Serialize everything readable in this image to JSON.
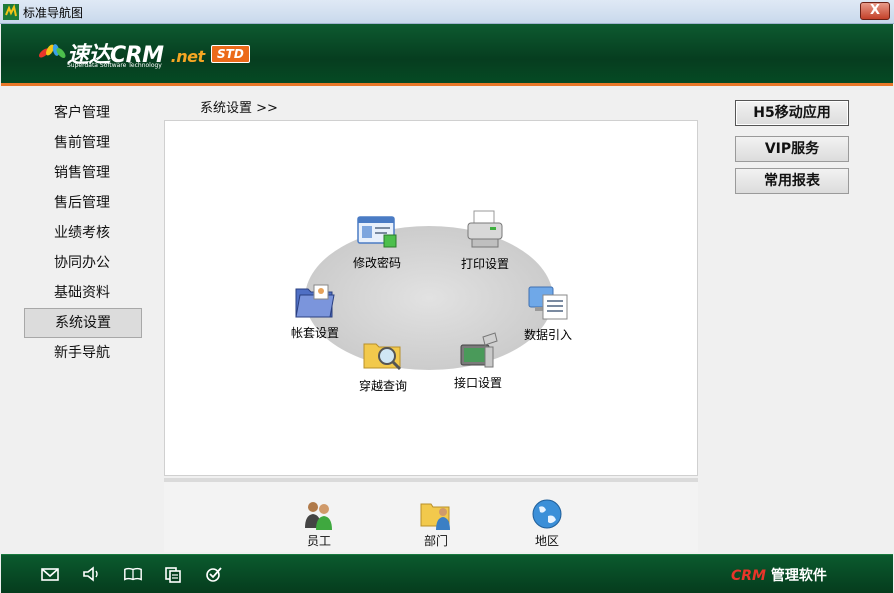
{
  "window": {
    "title": "标准导航图",
    "close_label": "X"
  },
  "header": {
    "logo_main": "速达CRM",
    "logo_net": ".net",
    "logo_sub": "Superdata Software Technology",
    "badge": "STD"
  },
  "nav": {
    "items": [
      {
        "label": "客户管理"
      },
      {
        "label": "售前管理"
      },
      {
        "label": "销售管理"
      },
      {
        "label": "售后管理"
      },
      {
        "label": "业绩考核"
      },
      {
        "label": "协同办公"
      },
      {
        "label": "基础资料"
      },
      {
        "label": "系统设置",
        "active": true
      },
      {
        "label": "新手导航"
      }
    ]
  },
  "breadcrumb": "系统设置 >>",
  "main": {
    "nodes": {
      "change_password": "修改密码",
      "print_settings": "打印设置",
      "data_import": "数据引入",
      "interface_settings": "接口设置",
      "cross_query": "穿越查询",
      "account_settings": "帐套设置"
    }
  },
  "bottom": {
    "employee": "员工",
    "department": "部门",
    "region": "地区"
  },
  "right": {
    "h5": "H5移动应用",
    "vip": "VIP服务",
    "reports": "常用报表"
  },
  "footer": {
    "brand_crm": "CRM",
    "brand_text": " 管理软件",
    "icons": [
      "mail-icon",
      "speaker-icon",
      "book-icon",
      "copy-icon",
      "check-icon"
    ]
  },
  "colors": {
    "banner": "#063d1f",
    "accent": "#e9782a",
    "badge": "#ec6a1a"
  }
}
